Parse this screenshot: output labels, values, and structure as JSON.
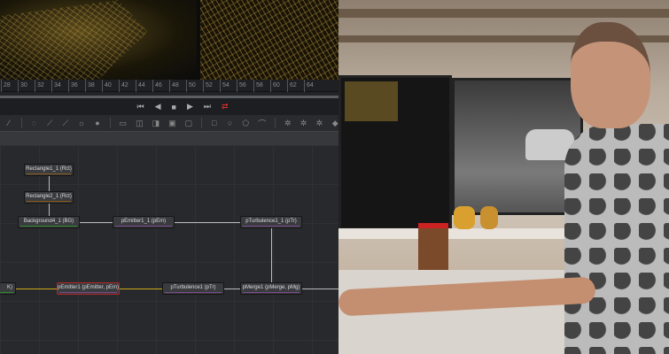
{
  "timeline": {
    "ticks": [
      "28",
      "30",
      "32",
      "34",
      "36",
      "38",
      "40",
      "42",
      "44",
      "46",
      "48",
      "50",
      "52",
      "54",
      "56",
      "58",
      "60",
      "62",
      "64"
    ]
  },
  "transport": {
    "first": "⏮",
    "prev": "◀",
    "stop": "■",
    "play": "▶",
    "last": "⏭",
    "loop": "⇄"
  },
  "nodes": {
    "rectangle1": "Rectangle1_1  (Rct)",
    "rectangle2": "Rectangle2_1  (Rct)",
    "background4": "Background4_1  (BG)",
    "pemitter1_1": "pEmitter1_1  (pEm)",
    "pturbulence1_1": "pTurbulence1_1  (pTr)",
    "partial": "K)",
    "pemitter1": "pEmitter1  (pEmitter, pEm)",
    "pturbulence1": "pTurbulence1  (pTr)",
    "pmerge1": "pMerge1  (pMerge, pMg)"
  },
  "colors": {
    "accent_loop": "#e03030",
    "selected_border": "#b02828"
  }
}
